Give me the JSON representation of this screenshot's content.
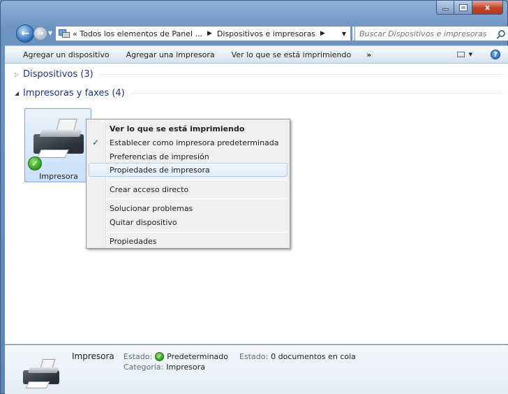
{
  "window": {
    "caption": {
      "minimize_glyph": "",
      "maximize_glyph": "",
      "close_glyph": "x"
    }
  },
  "nav": {
    "breadcrumb": [
      "« Todos los elementos de Panel ...",
      "Dispositivos e impresoras"
    ],
    "separator": "▶",
    "search_placeholder": "Buscar Dispositivos e impresoras"
  },
  "toolbar": {
    "items": [
      "Agregar un dispositivo",
      "Agregar una impresora",
      "Ver lo que se está imprimiendo"
    ],
    "more": "»",
    "help": "?"
  },
  "groups": [
    {
      "label": "Dispositivos (3)",
      "expanded": false
    },
    {
      "label": "Impresoras y faxes (4)",
      "expanded": true
    }
  ],
  "device": {
    "label": "Impresora",
    "default": true
  },
  "context_menu": {
    "items": [
      {
        "label": "Ver lo que se está imprimiendo",
        "bold": true
      },
      {
        "label": "Establecer como impresora predeterminada",
        "checked": true
      },
      {
        "label": "Preferencias de impresión"
      },
      {
        "label": "Propiedades de impresora",
        "hovered": true
      },
      {
        "label": "Crear acceso directo"
      },
      {
        "label": "Solucionar problemas"
      },
      {
        "label": "Quitar dispositivo"
      },
      {
        "label": "Propiedades"
      }
    ]
  },
  "details": {
    "title": "Impresora",
    "estado_key": "Estado:",
    "estado_value": "Predeterminado",
    "estado2_key": "Estado:",
    "estado2_value": "0 documentos en cola",
    "categoria_key": "Categoría:",
    "categoria_value": "Impresora"
  },
  "colors": {
    "accent": "#1e3287",
    "menu_hover_border": "#aecbf0",
    "check_green": "#2f9b1e"
  },
  "icons": [
    "back-arrow-icon",
    "forward-arrow-icon",
    "control-panel-icon",
    "refresh-icon",
    "search-icon",
    "view-options-icon",
    "help-icon",
    "printer-icon",
    "default-check-icon"
  ]
}
